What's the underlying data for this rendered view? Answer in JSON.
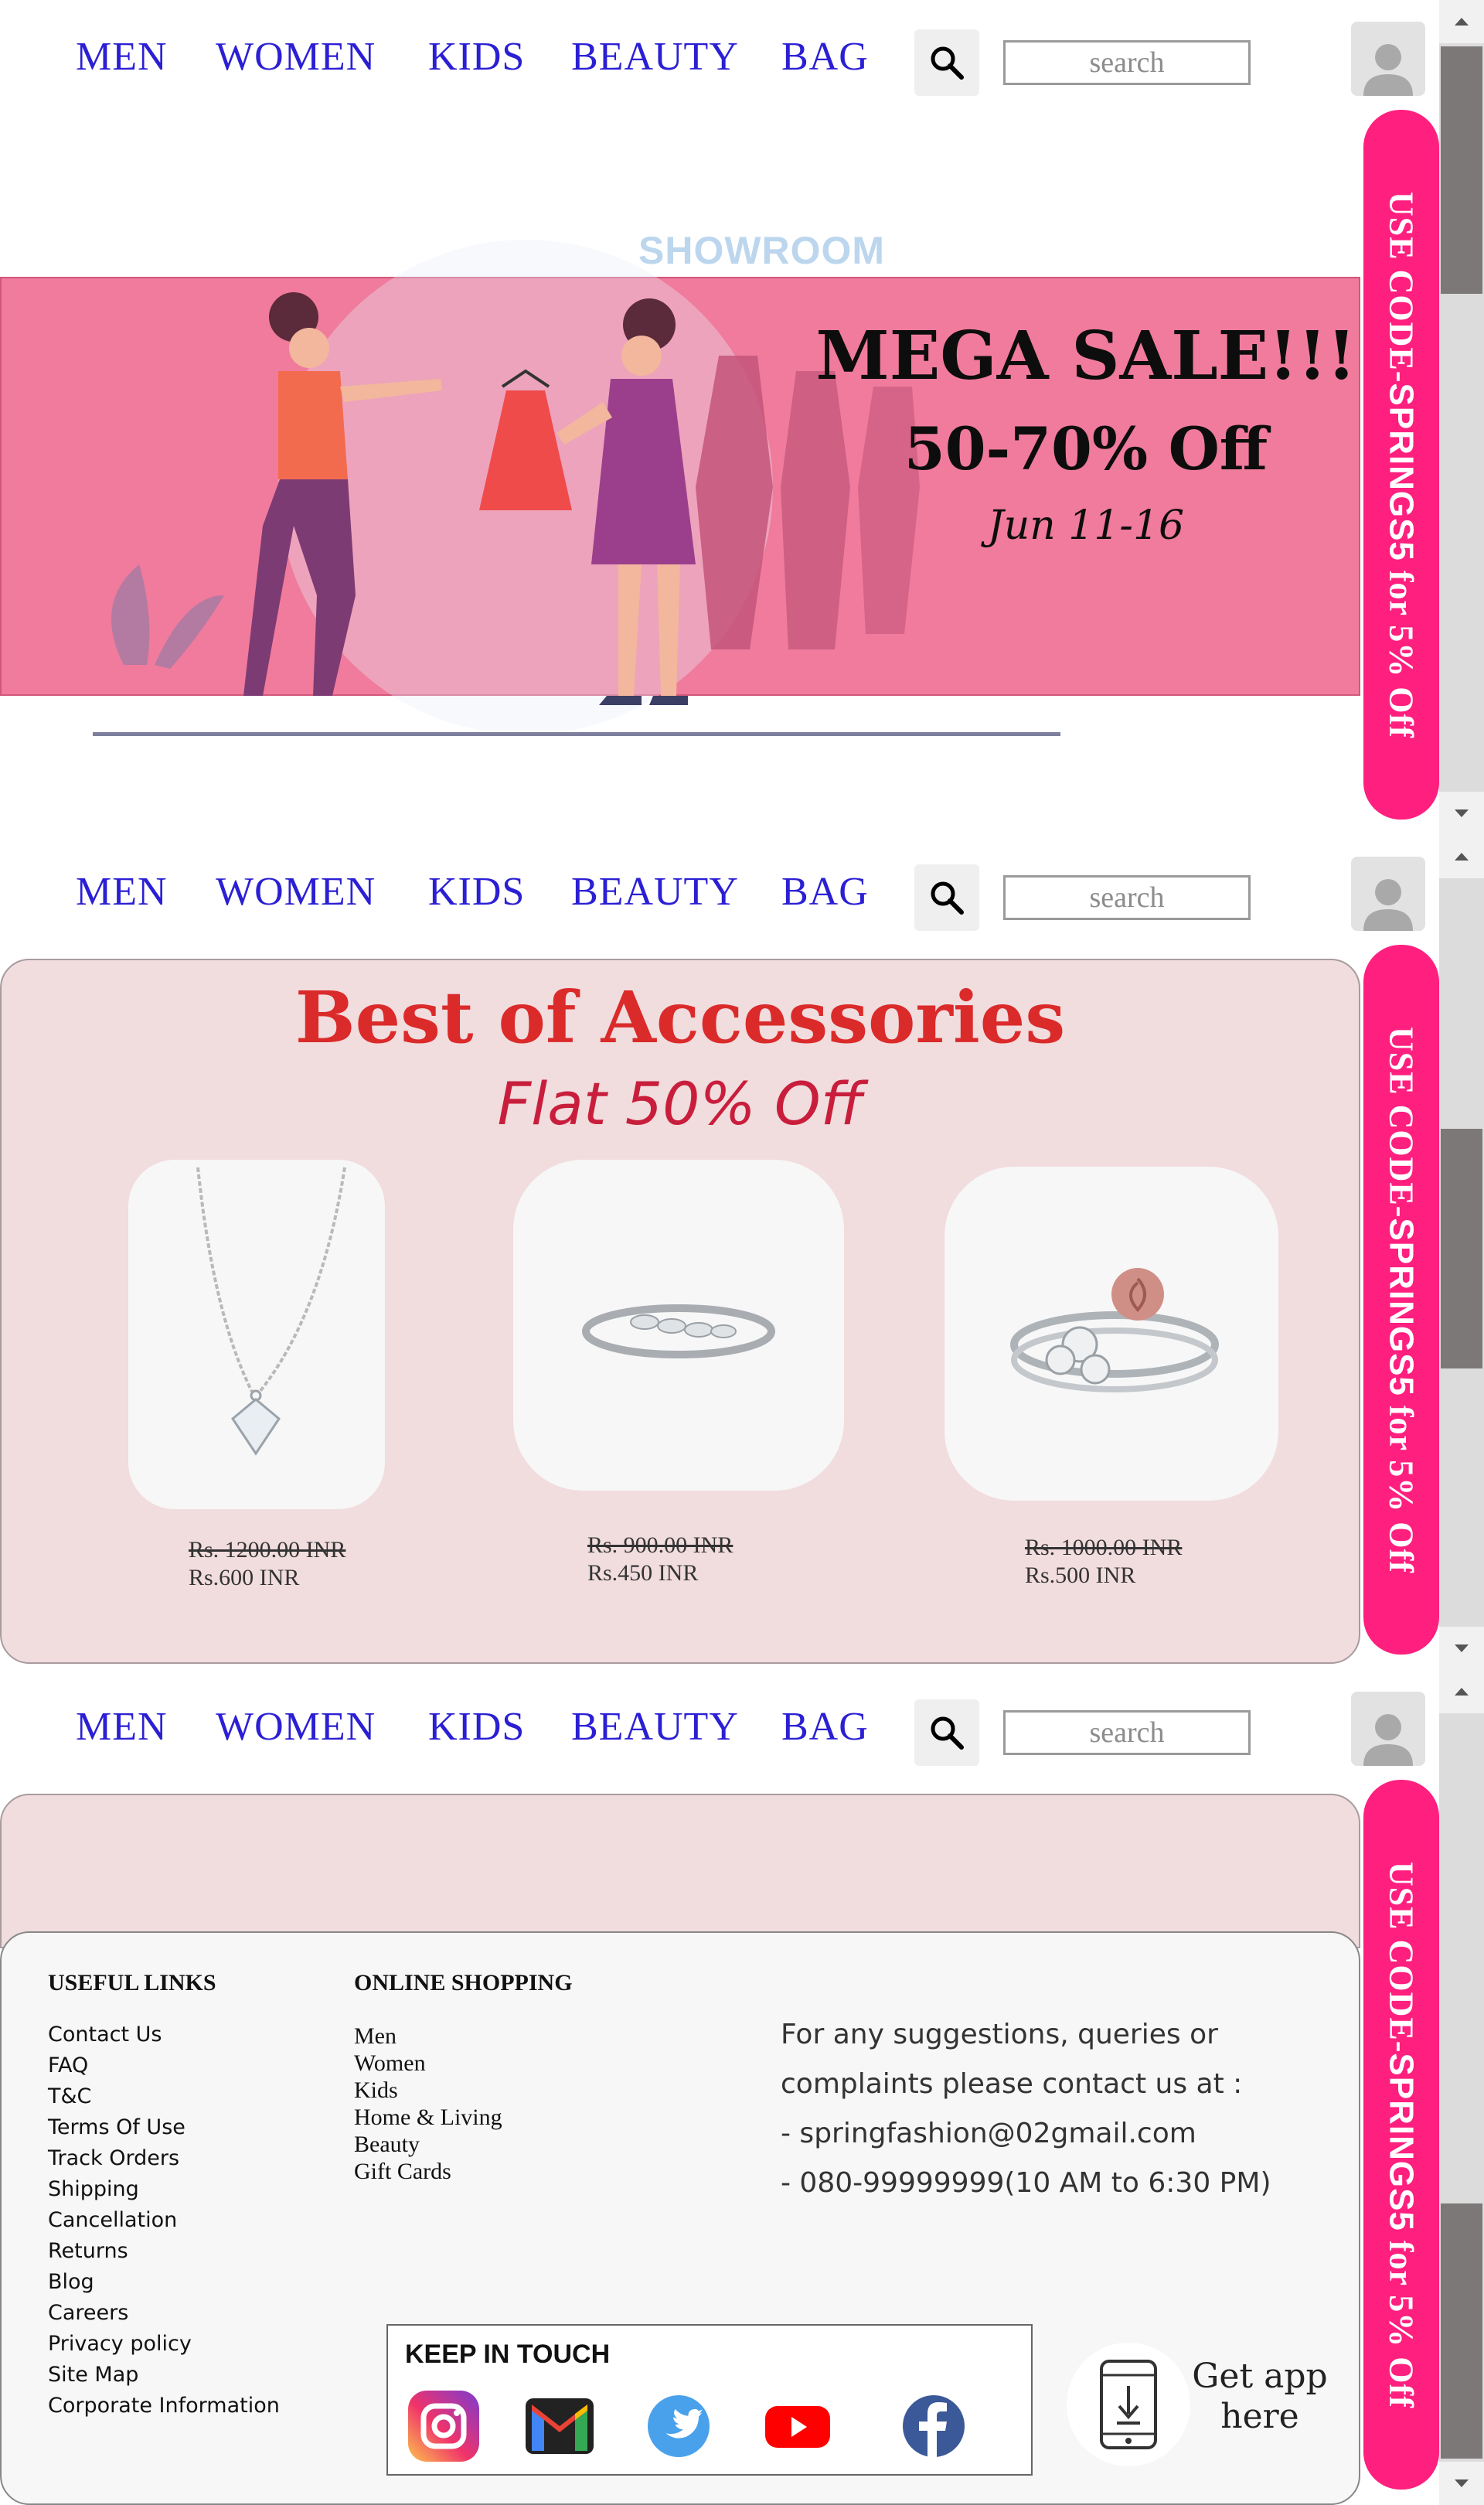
{
  "nav": {
    "links": [
      "MEN",
      "WOMEN",
      "KIDS",
      "BEAUTY",
      "BAG"
    ],
    "search_placeholder": "search"
  },
  "promo": {
    "prefix": "USE CODE-",
    "code": "SPRINGS5",
    "suffix": " for 5% Off"
  },
  "hero": {
    "watermark": "SHOWROOM",
    "headline": "MEGA SALE!!!",
    "discount": "50-70% Off",
    "dates": "Jun 11-16"
  },
  "accessories": {
    "title": "Best of Accessories",
    "subtitle": "Flat 50% Off",
    "products": [
      {
        "name": "heart-pendant-necklace",
        "old_price": "Rs. 1200.00 INR",
        "price": "Rs.600 INR"
      },
      {
        "name": "leaf-ring",
        "old_price": "Rs. 900.00 INR",
        "price": "Rs.450 INR"
      },
      {
        "name": "rose-flower-ring",
        "old_price": "Rs. 1000.00 INR",
        "price": "Rs.500 INR"
      }
    ]
  },
  "footer": {
    "useful_links_heading": "USEFUL LINKS",
    "useful_links": [
      "Contact Us",
      "FAQ",
      "T&C",
      "Terms Of Use",
      "Track Orders",
      "Shipping",
      "Cancellation",
      "Returns",
      "Blog",
      "Careers",
      "Privacy policy",
      "Site Map",
      "Corporate Information"
    ],
    "online_shopping_heading": "ONLINE SHOPPING",
    "online_shopping": [
      "Men",
      "Women",
      "Kids",
      "Home & Living",
      "Beauty",
      "Gift Cards"
    ],
    "contact_lines": [
      "For any suggestions, queries or",
      "complaints please contact us at :",
      "- springfashion@02gmail.com",
      "-  080-99999999(10 AM to 6:30 PM)"
    ],
    "keep_in_touch": "KEEP IN TOUCH",
    "social": [
      "instagram-icon",
      "gmail-icon",
      "twitter-icon",
      "youtube-icon",
      "facebook-icon"
    ],
    "app_line1": "Get app",
    "app_line2": "here"
  },
  "colors": {
    "nav_link": "#2b1fd4",
    "promo_bg": "#ff1f7f",
    "hero_band": "#f07b9c",
    "accessories_panel": "#f1dcde",
    "accessories_title": "#db2a2a"
  }
}
